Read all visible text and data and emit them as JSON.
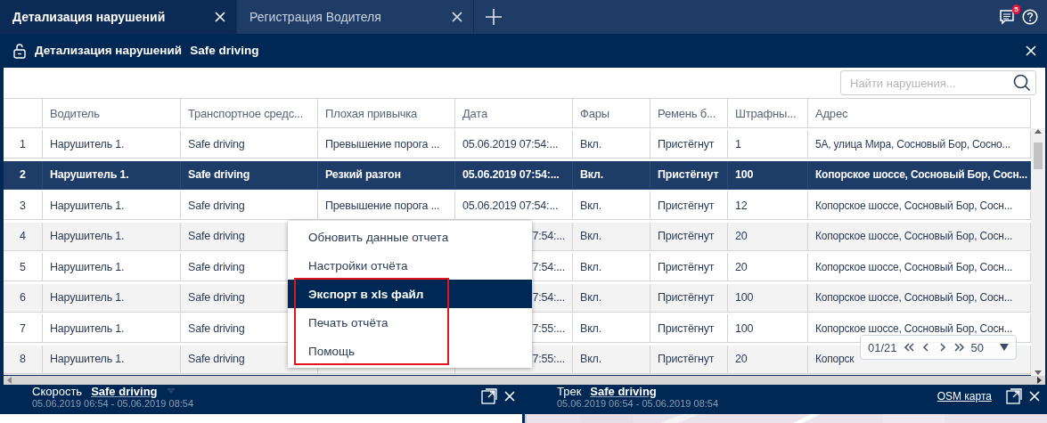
{
  "tabs": [
    {
      "label": "Детализация нарушений",
      "selected": true
    },
    {
      "label": "Регистрация Водителя",
      "selected": false
    }
  ],
  "notifications": {
    "count": "5"
  },
  "header": {
    "title": "Детализация нарушений",
    "subtitle": "Safe driving"
  },
  "search": {
    "placeholder": "Найти нарушения..."
  },
  "table": {
    "columns": [
      "Водитель",
      "Транспортное средс...",
      "Плохая привычка",
      "Дата",
      "Фары",
      "Ремень б...",
      "Штрафны...",
      "Адрес"
    ],
    "rows": [
      {
        "number": "1",
        "cells": [
          "Нарушитель 1.",
          "Safe driving",
          "Превышение порога ...",
          "05.06.2019 07:54:...",
          "Вкл.",
          "Пристёгнут",
          "1",
          "5А, улица Мира, Сосновый Бор, Сосно..."
        ],
        "selected": false
      },
      {
        "number": "2",
        "cells": [
          "Нарушитель 1.",
          "Safe driving",
          "Резкий разгон",
          "05.06.2019 07:54:...",
          "Вкл.",
          "Пристёгнут",
          "100",
          "Копорское шоссе, Сосновый Бор, Сосн..."
        ],
        "selected": true
      },
      {
        "number": "3",
        "cells": [
          "Нарушитель 1.",
          "Safe driving",
          "Превышение порога ...",
          "05.06.2019 07:54:...",
          "Вкл.",
          "Пристёгнут",
          "12",
          "Копорское шоссе, Сосновый Бор, Сосн..."
        ],
        "selected": false
      },
      {
        "number": "4",
        "cells": [
          "Нарушитель 1.",
          "Safe driving",
          null,
          "7:54:...",
          "Вкл.",
          "Пристёгнут",
          "20",
          "Копорское шоссе, Сосновый Бор, Сосн..."
        ],
        "selected": false
      },
      {
        "number": "5",
        "cells": [
          "Нарушитель 1.",
          "Safe driving",
          null,
          "7:54:...",
          "Вкл.",
          "Пристёгнут",
          "20",
          "Копорское шоссе, Сосновый Бор, Сосн..."
        ],
        "selected": false
      },
      {
        "number": "6",
        "cells": [
          "Нарушитель 1.",
          "Safe driving",
          null,
          "7:54:...",
          "Вкл.",
          "Пристёгнут",
          "100",
          "Копорское шоссе, Сосновый Бор, Сосн..."
        ],
        "selected": false
      },
      {
        "number": "7",
        "cells": [
          "Нарушитель 1.",
          "Safe driving",
          null,
          "7:55:...",
          "Вкл.",
          "Пристёгнут",
          "100",
          "Копорское шоссе, Сосновый Бор, Сосн..."
        ],
        "selected": false
      },
      {
        "number": "8",
        "cells": [
          "Нарушитель 1.",
          "Safe driving",
          null,
          "7:55:...",
          "Вкл.",
          "Пристёгнут",
          "20",
          "Копорск"
        ],
        "selected": false
      }
    ]
  },
  "context_menu": {
    "items": [
      {
        "label": "Обновить данные отчета",
        "selected": false,
        "annotated": false
      },
      {
        "label": "Настройки отчёта",
        "selected": false,
        "annotated": false
      },
      {
        "label": "Экспорт в xls файл",
        "selected": true,
        "annotated": true
      },
      {
        "label": "Печать отчёта",
        "selected": false,
        "annotated": true
      },
      {
        "label": "Помощь",
        "selected": false,
        "annotated": true
      }
    ]
  },
  "pager": {
    "page": "01/21",
    "page_size": "50"
  },
  "panels": [
    {
      "kind": "chart",
      "title": "Скорость",
      "source": "Safe driving",
      "period": "05.06.2019 06:54 - 05.06.2019 08:54"
    },
    {
      "kind": "map",
      "title": "Трек",
      "source": "Safe driving",
      "period": "05.06.2019 06:54 - 05.06.2019 08:54",
      "link": "OSM карта"
    }
  ]
}
